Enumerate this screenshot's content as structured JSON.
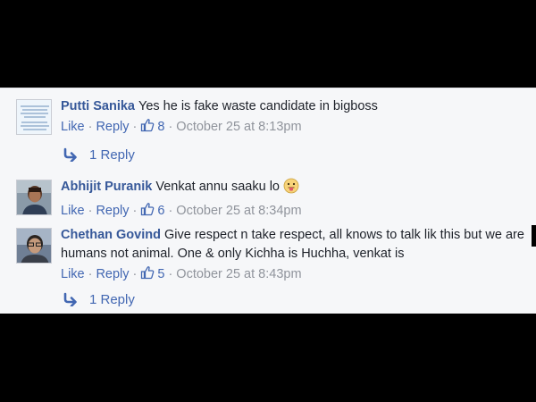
{
  "comments": [
    {
      "author": "Putti Sanika",
      "text": "Yes he is fake waste candidate in bigboss",
      "like_label": "Like",
      "reply_label": "Reply",
      "like_count": "8",
      "timestamp": "October 25 at 8:13pm",
      "replies_label": "1 Reply",
      "avatar_icon": "text-image-avatar"
    },
    {
      "author": "Abhijit Puranik",
      "text": "Venkat annu saaku lo",
      "emoji_icon": "tongue-out-emoji-icon",
      "like_label": "Like",
      "reply_label": "Reply",
      "like_count": "6",
      "timestamp": "October 25 at 8:34pm",
      "avatar_icon": "person-photo-avatar"
    },
    {
      "author": "Chethan Govind",
      "text": "Give respect n take respect, all knows to talk lik this but we are humans not animal. One & only Kichha is Huchha, venkat is",
      "like_label": "Like",
      "reply_label": "Reply",
      "like_count": "5",
      "timestamp": "October 25 at 8:43pm",
      "replies_label": "1 Reply",
      "avatar_icon": "person-photo-avatar"
    }
  ],
  "colors": {
    "author": "#365899",
    "link": "#4267b2",
    "meta": "#90949c",
    "text": "#1d2129",
    "panel": "#f6f7f9"
  }
}
